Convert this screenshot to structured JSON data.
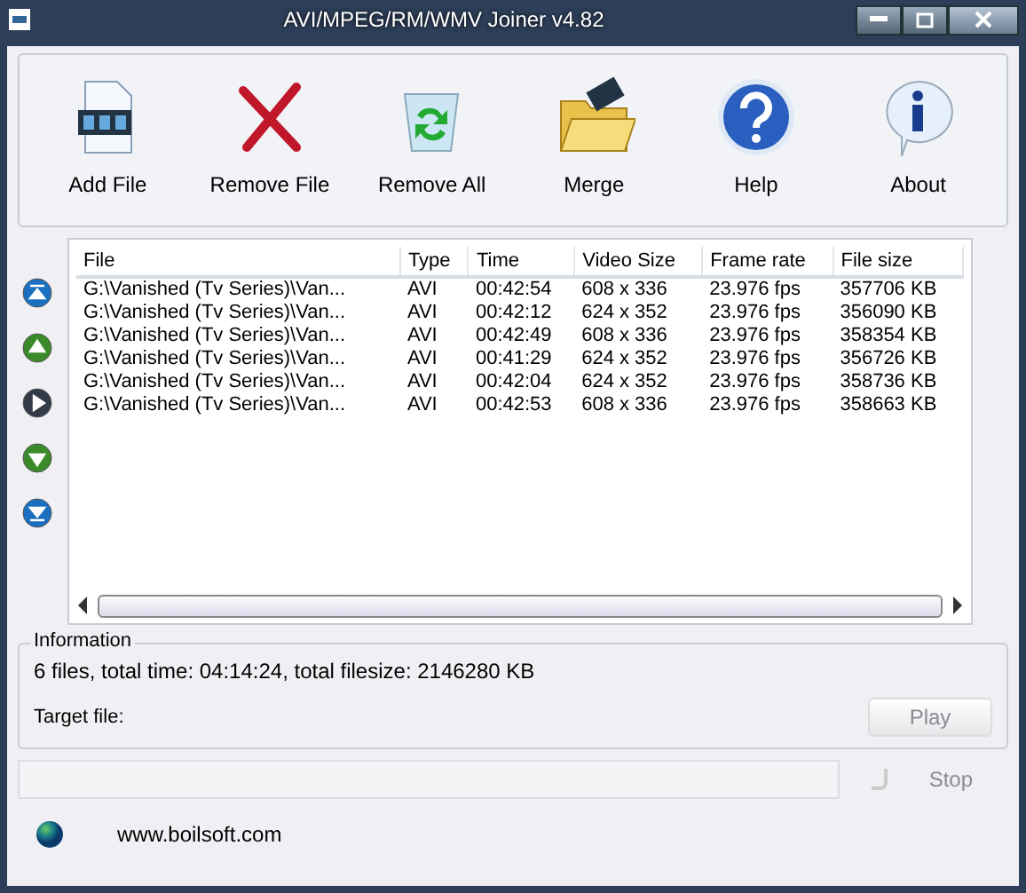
{
  "window": {
    "title": "AVI/MPEG/RM/WMV Joiner v4.82"
  },
  "toolbar": [
    {
      "kind": "add",
      "label": "Add File"
    },
    {
      "kind": "remove",
      "label": "Remove File"
    },
    {
      "kind": "clear",
      "label": "Remove All"
    },
    {
      "kind": "merge",
      "label": "Merge"
    },
    {
      "kind": "help",
      "label": "Help"
    },
    {
      "kind": "about",
      "label": "About"
    }
  ],
  "side_buttons": [
    {
      "kind": "top"
    },
    {
      "kind": "up"
    },
    {
      "kind": "play"
    },
    {
      "kind": "down"
    },
    {
      "kind": "bottom"
    }
  ],
  "table": {
    "columns": [
      "File",
      "Type",
      "Time",
      "Video Size",
      "Frame rate",
      "File size"
    ],
    "rows": [
      [
        "G:\\Vanished (Tv Series)\\Van...",
        "AVI",
        "00:42:54",
        "608 x 336",
        "23.976 fps",
        "357706 KB"
      ],
      [
        "G:\\Vanished (Tv Series)\\Van...",
        "AVI",
        "00:42:12",
        "624 x 352",
        "23.976 fps",
        "356090 KB"
      ],
      [
        "G:\\Vanished (Tv Series)\\Van...",
        "AVI",
        "00:42:49",
        "608 x 336",
        "23.976 fps",
        "358354 KB"
      ],
      [
        "G:\\Vanished (Tv Series)\\Van...",
        "AVI",
        "00:41:29",
        "624 x 352",
        "23.976 fps",
        "356726 KB"
      ],
      [
        "G:\\Vanished (Tv Series)\\Van...",
        "AVI",
        "00:42:04",
        "624 x 352",
        "23.976 fps",
        "358736 KB"
      ],
      [
        "G:\\Vanished (Tv Series)\\Van...",
        "AVI",
        "00:42:53",
        "608 x 336",
        "23.976 fps",
        "358663 KB"
      ]
    ]
  },
  "information": {
    "title": "Information",
    "summary": "6 files, total time: 04:14:24, total filesize: 2146280 KB",
    "target_label": "Target file:",
    "play_button": {
      "label": "Play",
      "disabled": true
    }
  },
  "progress": {
    "level": 0
  },
  "stop_button": {
    "label": "Stop",
    "disabled": true
  },
  "footer": {
    "link": "www.boilsoft.com"
  }
}
